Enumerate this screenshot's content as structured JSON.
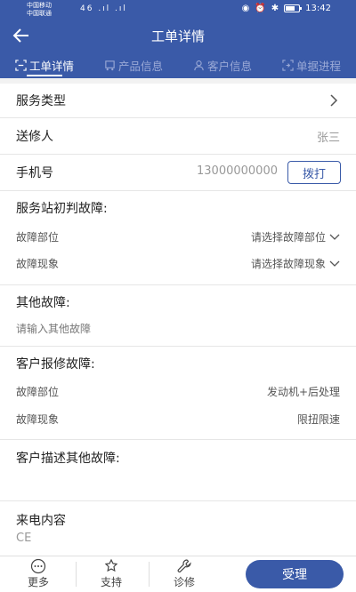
{
  "status_bar": {
    "carrier1": "中国移动",
    "carrier2": "中国联通",
    "signal": "46 .ıl .ıl",
    "time": "13:42"
  },
  "header": {
    "title": "工单详情"
  },
  "tabs": [
    {
      "label": "工单详情",
      "icon": "scan-icon",
      "active": true
    },
    {
      "label": "产品信息",
      "icon": "truck-icon",
      "active": false
    },
    {
      "label": "客户信息",
      "icon": "person-icon",
      "active": false
    },
    {
      "label": "单据进程",
      "icon": "process-icon",
      "active": false
    }
  ],
  "form": {
    "service_type_label": "服务类型",
    "sender_label": "送修人",
    "sender_value": "张三",
    "phone_label": "手机号",
    "phone_value": "13000000000",
    "dial_label": "拨打",
    "station_fault_title": "服务站初判故障:",
    "fault_part_label": "故障部位",
    "fault_part_placeholder": "请选择故障部位",
    "fault_phenom_label": "故障现象",
    "fault_phenom_placeholder": "请选择故障现象",
    "other_fault_title": "其他故障:",
    "other_fault_placeholder": "请输入其他故障",
    "customer_fault_title": "客户报修故障:",
    "cust_part_label": "故障部位",
    "cust_part_value": "发动机+后处理",
    "cust_phenom_label": "故障现象",
    "cust_phenom_value": "限扭限速",
    "cust_other_title": "客户描述其他故障:",
    "incoming_label": "来电内容",
    "incoming_value": "CE"
  },
  "bottom_bar": {
    "more": "更多",
    "support": "支持",
    "diagnose": "诊修",
    "accept": "受理"
  },
  "colors": {
    "primary": "#3a5aa8"
  }
}
